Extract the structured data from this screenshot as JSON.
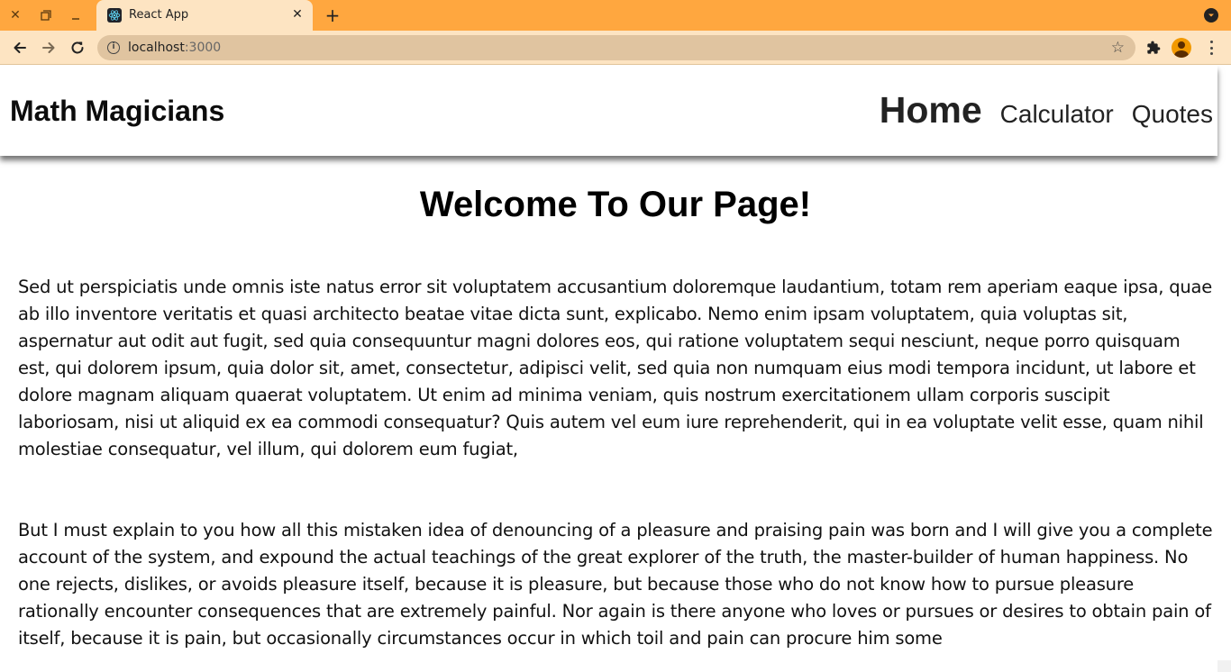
{
  "browser": {
    "tab_title": "React App",
    "url_host": "localhost",
    "url_port": ":3000",
    "accent_color": "#ffa73f",
    "toolbar_color": "#fde4c2"
  },
  "site": {
    "brand": "Math Magicians",
    "nav": [
      {
        "label": "Home",
        "active": true
      },
      {
        "label": "Calculator",
        "active": false
      },
      {
        "label": "Quotes",
        "active": false
      }
    ]
  },
  "main": {
    "title": "Welcome To Our Page!",
    "paragraphs": [
      "Sed ut perspiciatis unde omnis iste natus error sit voluptatem accusantium doloremque laudantium, totam rem aperiam eaque ipsa, quae ab illo inventore veritatis et quasi architecto beatae vitae dicta sunt, explicabo. Nemo enim ipsam voluptatem, quia voluptas sit, aspernatur aut odit aut fugit, sed quia consequuntur magni dolores eos, qui ratione voluptatem sequi nesciunt, neque porro quisquam est, qui dolorem ipsum, quia dolor sit, amet, consectetur, adipisci velit, sed quia non numquam eius modi tempora incidunt, ut labore et dolore magnam aliquam quaerat voluptatem. Ut enim ad minima veniam, quis nostrum exercitationem ullam corporis suscipit laboriosam, nisi ut aliquid ex ea commodi consequatur? Quis autem vel eum iure reprehenderit, qui in ea voluptate velit esse, quam nihil molestiae consequatur, vel illum, qui dolorem eum fugiat,",
      "But I must explain to you how all this mistaken idea of denouncing of a pleasure and praising pain was born and I will give you a complete account of the system, and expound the actual teachings of the great explorer of the truth, the master-builder of human happiness. No one rejects, dislikes, or avoids pleasure itself, because it is pleasure, but because those who do not know how to pursue pleasure rationally encounter consequences that are extremely painful. Nor again is there anyone who loves or pursues or desires to obtain pain of itself, because it is pain, but occasionally circumstances occur in which toil and pain can procure him some"
    ]
  },
  "icons": {
    "close_window": "close-icon",
    "restore_window": "restore-icon",
    "minimize_window": "minimize-icon",
    "favicon": "react-icon",
    "tab_close": "close-icon",
    "new_tab": "plus-icon",
    "tab_search": "chevron-down-icon",
    "back": "arrow-left-icon",
    "forward": "arrow-right-icon",
    "reload": "reload-icon",
    "site_info": "info-icon",
    "bookmark": "star-icon",
    "extensions": "puzzle-icon",
    "profile": "avatar-icon",
    "menu": "kebab-icon"
  }
}
